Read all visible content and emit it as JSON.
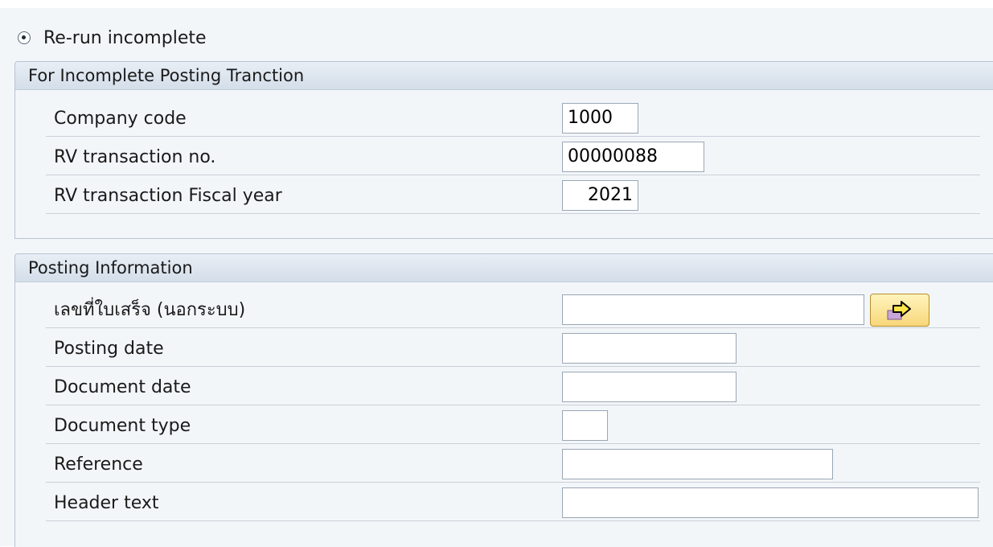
{
  "radio": {
    "label": "Re-run incomplete",
    "selected": true
  },
  "group1": {
    "title": "For Incomplete Posting Tranction",
    "fields": [
      {
        "label": "Company code",
        "value": "1000"
      },
      {
        "label": "RV transaction no.",
        "value": "00000088"
      },
      {
        "label": "RV transaction Fiscal year",
        "value": "2021"
      }
    ]
  },
  "group2": {
    "title": "Posting Information",
    "fields": [
      {
        "label": "เลขที่ใบเสร็จ (นอกระบบ)",
        "value": ""
      },
      {
        "label": "Posting date",
        "value": ""
      },
      {
        "label": "Document date",
        "value": ""
      },
      {
        "label": "Document type",
        "value": ""
      },
      {
        "label": "Reference",
        "value": ""
      },
      {
        "label": "Header text",
        "value": ""
      }
    ],
    "nav_button_icon": "arrow-right-icon"
  },
  "colors": {
    "header_bg": "#dbe3ec",
    "button_yellow": "#f7d77a"
  }
}
